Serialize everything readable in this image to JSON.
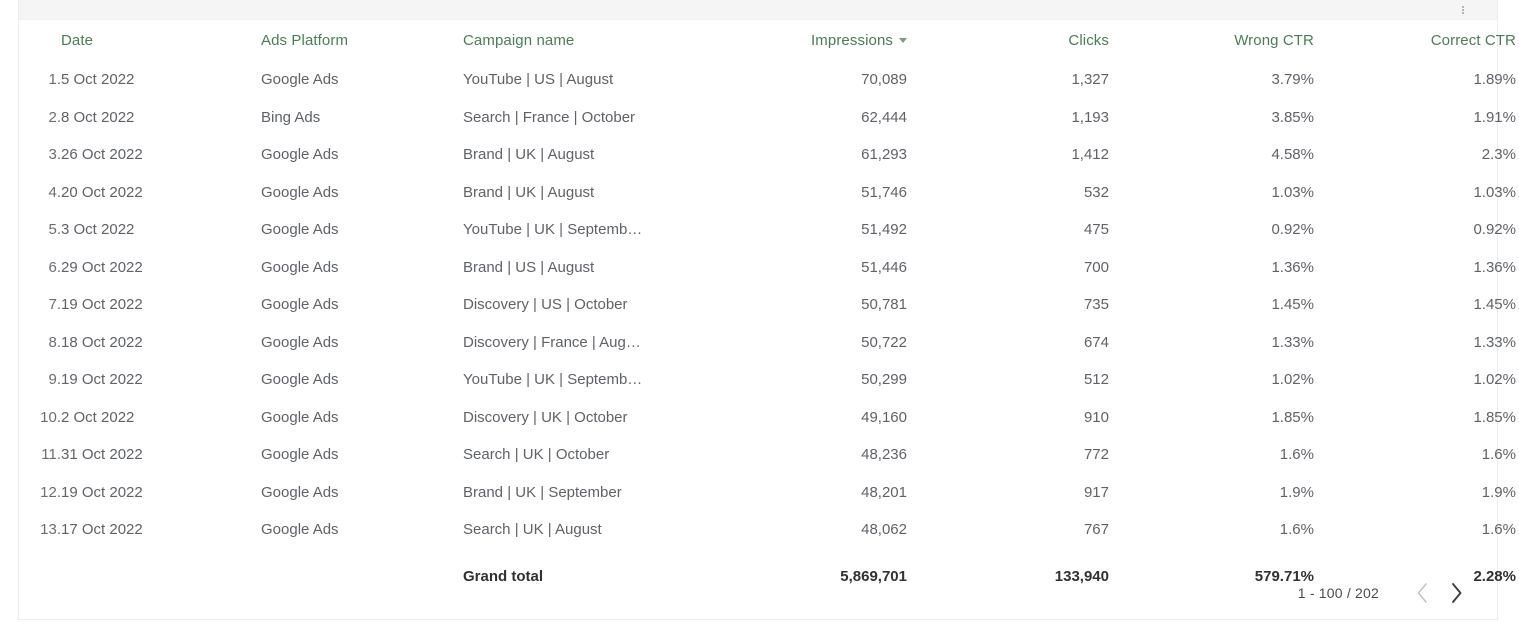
{
  "table": {
    "toolbar": {
      "options_icon": "more-vertical-icon"
    },
    "columns": [
      {
        "key": "index",
        "label": "",
        "align": "right"
      },
      {
        "key": "date",
        "label": "Date",
        "align": "left"
      },
      {
        "key": "platform",
        "label": "Ads Platform",
        "align": "left"
      },
      {
        "key": "campaign",
        "label": "Campaign name",
        "align": "left"
      },
      {
        "key": "impressions",
        "label": "Impressions",
        "align": "right",
        "sorted": "desc"
      },
      {
        "key": "clicks",
        "label": "Clicks",
        "align": "right"
      },
      {
        "key": "wrong_ctr",
        "label": "Wrong CTR",
        "align": "right"
      },
      {
        "key": "correct_ctr",
        "label": "Correct CTR",
        "align": "right"
      }
    ],
    "header_color": "#4d7c59",
    "rows": [
      {
        "index": "1.",
        "date": "5 Oct 2022",
        "platform": "Google Ads",
        "campaign": "YouTube | US | August",
        "impressions": "70,089",
        "clicks": "1,327",
        "wrong_ctr": "3.79%",
        "correct_ctr": "1.89%"
      },
      {
        "index": "2.",
        "date": "8 Oct 2022",
        "platform": "Bing Ads",
        "campaign": "Search | France | October",
        "impressions": "62,444",
        "clicks": "1,193",
        "wrong_ctr": "3.85%",
        "correct_ctr": "1.91%"
      },
      {
        "index": "3.",
        "date": "26 Oct 2022",
        "platform": "Google Ads",
        "campaign": "Brand | UK | August",
        "impressions": "61,293",
        "clicks": "1,412",
        "wrong_ctr": "4.58%",
        "correct_ctr": "2.3%"
      },
      {
        "index": "4.",
        "date": "20 Oct 2022",
        "platform": "Google Ads",
        "campaign": "Brand | UK | August",
        "impressions": "51,746",
        "clicks": "532",
        "wrong_ctr": "1.03%",
        "correct_ctr": "1.03%"
      },
      {
        "index": "5.",
        "date": "3 Oct 2022",
        "platform": "Google Ads",
        "campaign": "YouTube | UK | Septemb…",
        "impressions": "51,492",
        "clicks": "475",
        "wrong_ctr": "0.92%",
        "correct_ctr": "0.92%"
      },
      {
        "index": "6.",
        "date": "29 Oct 2022",
        "platform": "Google Ads",
        "campaign": "Brand | US | August",
        "impressions": "51,446",
        "clicks": "700",
        "wrong_ctr": "1.36%",
        "correct_ctr": "1.36%"
      },
      {
        "index": "7.",
        "date": "19 Oct 2022",
        "platform": "Google Ads",
        "campaign": "Discovery | US | October",
        "impressions": "50,781",
        "clicks": "735",
        "wrong_ctr": "1.45%",
        "correct_ctr": "1.45%"
      },
      {
        "index": "8.",
        "date": "18 Oct 2022",
        "platform": "Google Ads",
        "campaign": "Discovery | France | Aug…",
        "impressions": "50,722",
        "clicks": "674",
        "wrong_ctr": "1.33%",
        "correct_ctr": "1.33%"
      },
      {
        "index": "9.",
        "date": "19 Oct 2022",
        "platform": "Google Ads",
        "campaign": "YouTube | UK | Septemb…",
        "impressions": "50,299",
        "clicks": "512",
        "wrong_ctr": "1.02%",
        "correct_ctr": "1.02%"
      },
      {
        "index": "10.",
        "date": "2 Oct 2022",
        "platform": "Google Ads",
        "campaign": "Discovery | UK | October",
        "impressions": "49,160",
        "clicks": "910",
        "wrong_ctr": "1.85%",
        "correct_ctr": "1.85%"
      },
      {
        "index": "11.",
        "date": "31 Oct 2022",
        "platform": "Google Ads",
        "campaign": "Search | UK | October",
        "impressions": "48,236",
        "clicks": "772",
        "wrong_ctr": "1.6%",
        "correct_ctr": "1.6%"
      },
      {
        "index": "12.",
        "date": "19 Oct 2022",
        "platform": "Google Ads",
        "campaign": "Brand | UK | September",
        "impressions": "48,201",
        "clicks": "917",
        "wrong_ctr": "1.9%",
        "correct_ctr": "1.9%"
      },
      {
        "index": "13.",
        "date": "17 Oct 2022",
        "platform": "Google Ads",
        "campaign": "Search | UK | August",
        "impressions": "48,062",
        "clicks": "767",
        "wrong_ctr": "1.6%",
        "correct_ctr": "1.6%"
      }
    ],
    "grand_total": {
      "label": "Grand total",
      "impressions": "5,869,701",
      "clicks": "133,940",
      "wrong_ctr": "579.71%",
      "correct_ctr": "2.28%"
    },
    "pagination": {
      "range": "1 - 100 / 202",
      "prev_icon": "chevron-left-icon",
      "next_icon": "chevron-right-icon",
      "prev_enabled": false,
      "next_enabled": true
    }
  }
}
